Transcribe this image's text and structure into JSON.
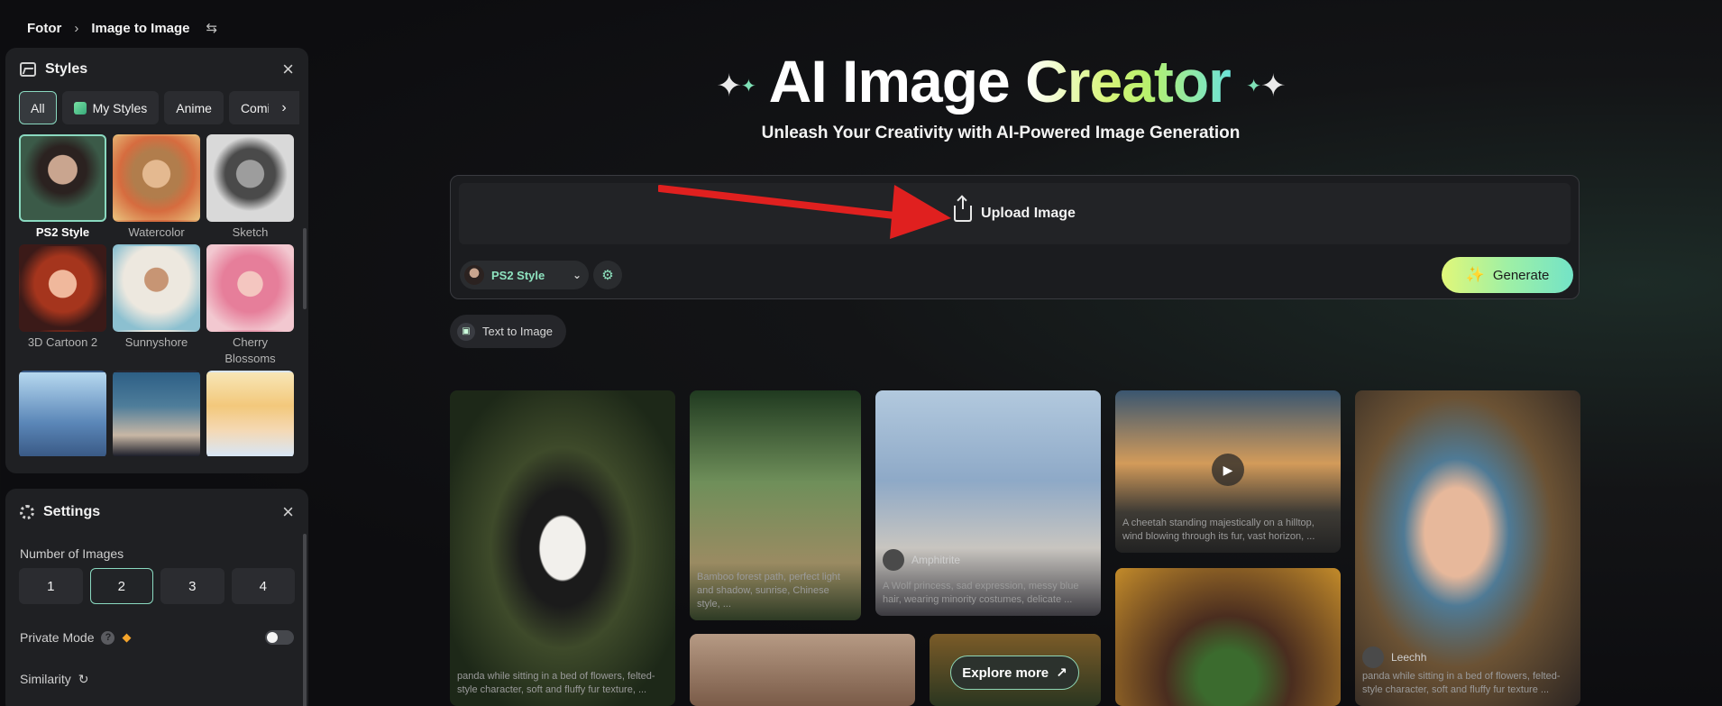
{
  "breadcrumb": {
    "root": "Fotor",
    "current": "Image to Image"
  },
  "styles_panel": {
    "title": "Styles",
    "chips": [
      {
        "label": "All",
        "active": true
      },
      {
        "label": "My Styles",
        "active": false
      },
      {
        "label": "Anime",
        "active": false
      },
      {
        "label": "Comic",
        "active": false
      }
    ],
    "items": [
      {
        "label": "PS2 Style",
        "active": true
      },
      {
        "label": "Watercolor",
        "active": false
      },
      {
        "label": "Sketch",
        "active": false
      },
      {
        "label": "3D Cartoon 2",
        "active": false
      },
      {
        "label": "Sunnyshore",
        "active": false
      },
      {
        "label": "Cherry Blossoms",
        "active": false
      },
      {
        "label": "",
        "active": false
      },
      {
        "label": "",
        "active": false
      },
      {
        "label": "",
        "active": false
      }
    ]
  },
  "settings_panel": {
    "title": "Settings",
    "number_of_images_label": "Number of Images",
    "number_options": [
      "1",
      "2",
      "3",
      "4"
    ],
    "selected_number": "2",
    "private_mode_label": "Private Mode",
    "private_mode_on": false,
    "similarity_label": "Similarity"
  },
  "hero": {
    "title_part1": "AI Image",
    "title_part2": "Creator",
    "subtitle": "Unleash Your Creativity with AI-Powered Image Generation"
  },
  "composer": {
    "upload_label": "Upload Image",
    "selected_style": "PS2 Style",
    "generate_label": "Generate",
    "text_to_image_label": "Text to Image"
  },
  "gallery": {
    "explore_label": "Explore more",
    "captions": {
      "g1": "panda while sitting in a bed of flowers, felted-style character, soft and fluffy fur texture, ...",
      "g2": "Bamboo forest path, perfect light and shadow, sunrise, Chinese style, ...",
      "g3": "A Wolf princess, sad expression, messy blue hair, wearing minority costumes, delicate ...",
      "g4": "A cheetah standing majestically on a hilltop, wind blowing through its fur, vast horizon, ...",
      "g5": "panda while sitting in a bed of flowers, felted-style character, soft and fluffy fur texture ..."
    },
    "authors": {
      "g3": "Amphitrite",
      "g5": "Leechh"
    }
  },
  "colors": {
    "accent": "#8ad9c0",
    "generate_gradient_start": "#e1f779",
    "generate_gradient_end": "#73e3c7",
    "arrow": "#e0201f"
  }
}
